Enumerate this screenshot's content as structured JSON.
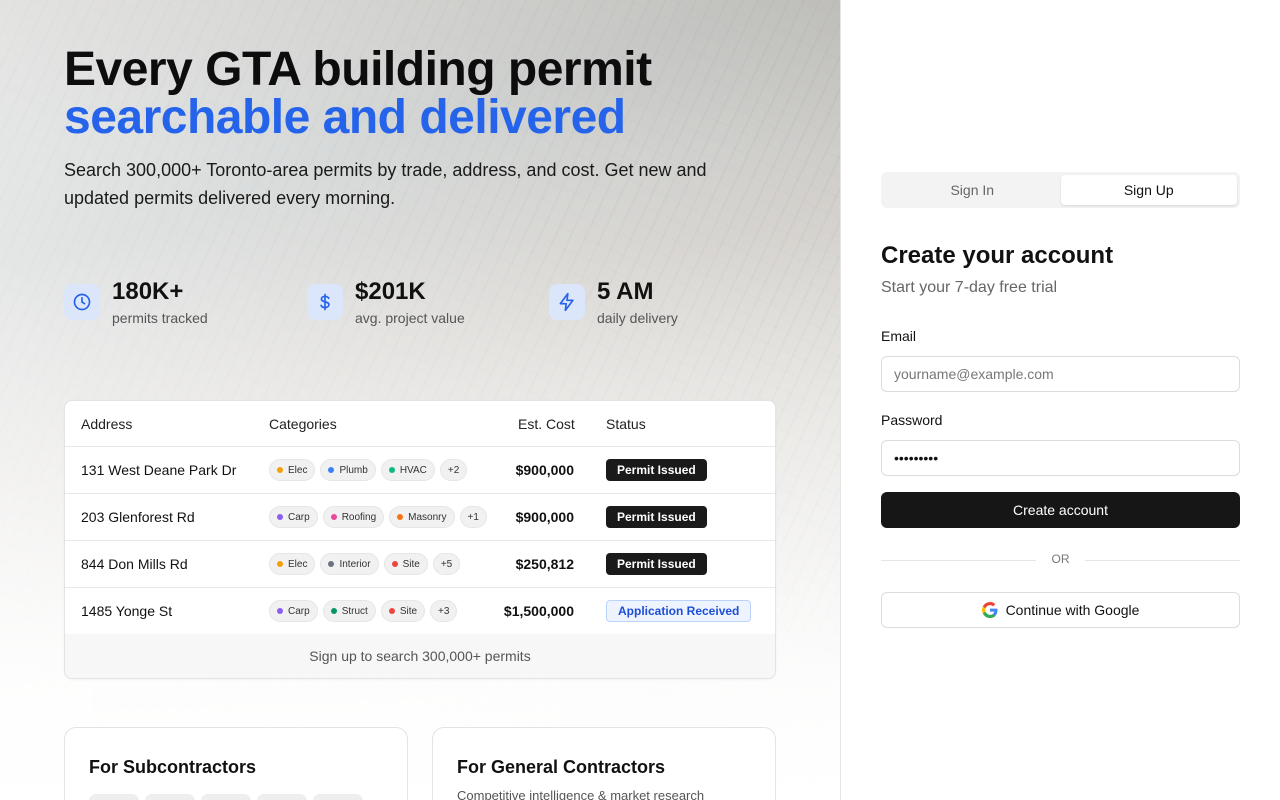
{
  "hero": {
    "title_line1": "Every GTA building permit",
    "title_line2": "searchable and delivered",
    "subtitle": "Search 300,000+ Toronto-area permits by trade, address, and cost. Get new and updated permits delivered every morning."
  },
  "stats": [
    {
      "icon": "clock-icon",
      "value": "180K+",
      "label": "permits tracked"
    },
    {
      "icon": "dollar-icon",
      "value": "$201K",
      "label": "avg. project value"
    },
    {
      "icon": "lightning-icon",
      "value": "5 AM",
      "label": "daily delivery"
    }
  ],
  "table": {
    "headers": {
      "address": "Address",
      "categories": "Categories",
      "cost": "Est. Cost",
      "status": "Status"
    },
    "rows": [
      {
        "address": "131 West Deane Park Dr",
        "categories": [
          {
            "name": "Elec",
            "color": "#f59e0b"
          },
          {
            "name": "Plumb",
            "color": "#3b82f6"
          },
          {
            "name": "HVAC",
            "color": "#10b981"
          }
        ],
        "more": "+2",
        "cost": "$900,000",
        "status": "Permit Issued",
        "status_type": "issued"
      },
      {
        "address": "203 Glenforest Rd",
        "categories": [
          {
            "name": "Carp",
            "color": "#8b5cf6"
          },
          {
            "name": "Roofing",
            "color": "#ec4899"
          },
          {
            "name": "Masonry",
            "color": "#f97316"
          }
        ],
        "more": "+1",
        "cost": "$900,000",
        "status": "Permit Issued",
        "status_type": "issued"
      },
      {
        "address": "844 Don Mills Rd",
        "categories": [
          {
            "name": "Elec",
            "color": "#f59e0b"
          },
          {
            "name": "Interior",
            "color": "#6b7280"
          },
          {
            "name": "Site",
            "color": "#ef4444"
          }
        ],
        "more": "+5",
        "cost": "$250,812",
        "status": "Permit Issued",
        "status_type": "issued"
      },
      {
        "address": "1485 Yonge St",
        "categories": [
          {
            "name": "Carp",
            "color": "#8b5cf6"
          },
          {
            "name": "Struct",
            "color": "#059669"
          },
          {
            "name": "Site",
            "color": "#ef4444"
          }
        ],
        "more": "+3",
        "cost": "$1,500,000",
        "status": "Application Received",
        "status_type": "received"
      }
    ],
    "footer": "Sign up to search 300,000+ permits"
  },
  "features": {
    "sub": {
      "title": "For Subcontractors"
    },
    "gc": {
      "title": "For General Contractors",
      "desc": "Competitive intelligence & market research"
    }
  },
  "auth": {
    "tab_signin": "Sign In",
    "tab_signup": "Sign Up",
    "active_tab": "Sign Up",
    "title": "Create your account",
    "subtitle": "Start your 7-day free trial",
    "email_label": "Email",
    "email_placeholder": "yourname@example.com",
    "password_label": "Password",
    "password_value": "password1",
    "submit_label": "Create account",
    "or_label": "OR",
    "google_label": "Continue with Google"
  },
  "colors": {
    "accent": "#2563eb",
    "primary_button": "#161616"
  }
}
